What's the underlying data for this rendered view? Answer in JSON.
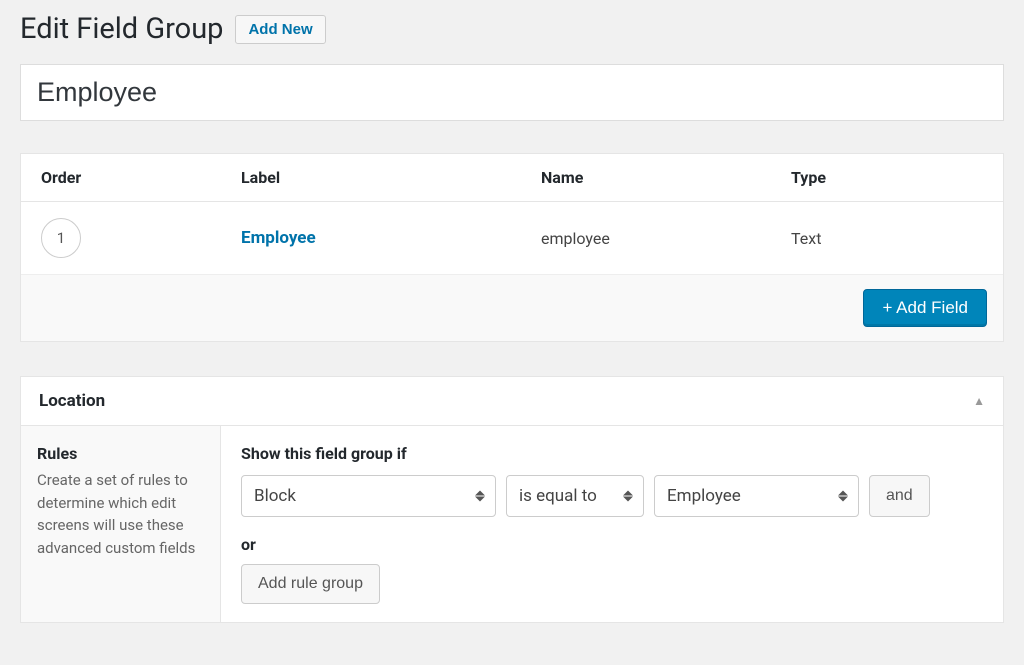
{
  "header": {
    "title": "Edit Field Group",
    "add_new_label": "Add New"
  },
  "group_title": "Employee",
  "fields_table": {
    "columns": {
      "order": "Order",
      "label": "Label",
      "name": "Name",
      "type": "Type"
    },
    "rows": [
      {
        "order": "1",
        "label": "Employee",
        "name": "employee",
        "type": "Text"
      }
    ],
    "add_field_label": "+ Add Field"
  },
  "location": {
    "panel_title": "Location",
    "rules_heading": "Rules",
    "rules_description": "Create a set of rules to determine which edit screens will use these advanced custom fields",
    "show_if_label": "Show this field group if",
    "rule": {
      "param": "Block",
      "operator": "is equal to",
      "value": "Employee",
      "and_label": "and"
    },
    "or_label": "or",
    "add_rule_group_label": "Add rule group"
  }
}
